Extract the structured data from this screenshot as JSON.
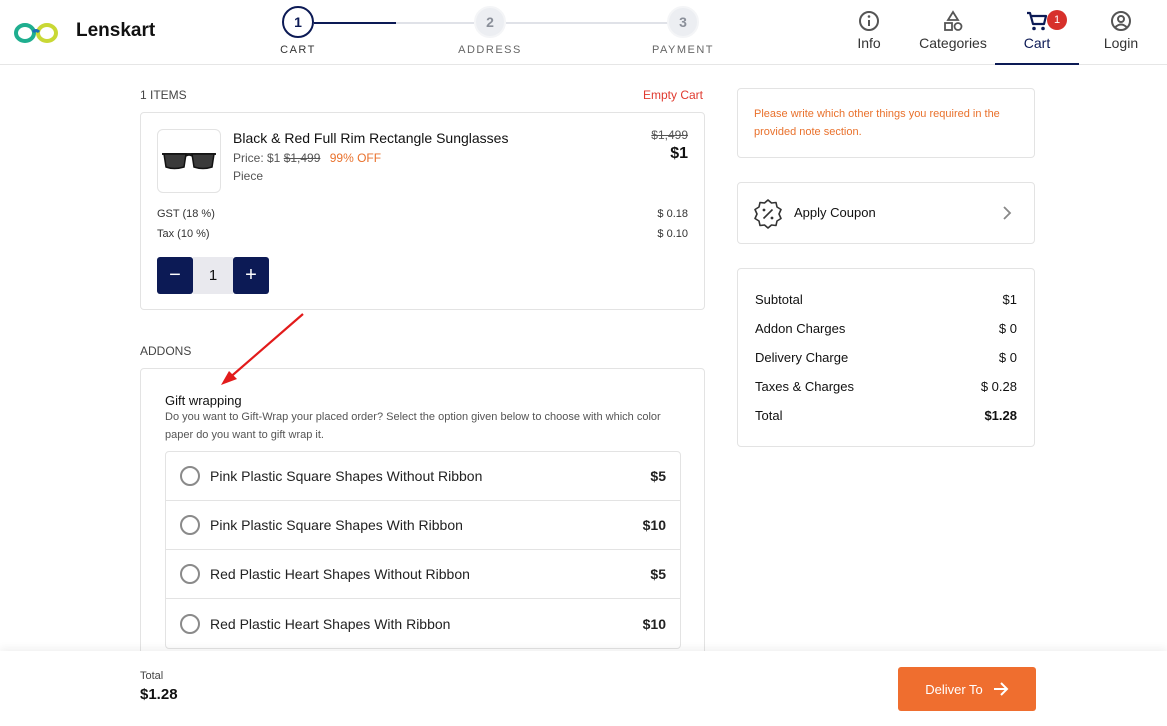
{
  "header": {
    "brand": "Lenskart",
    "steps": [
      {
        "number": "1",
        "label": "CART"
      },
      {
        "number": "2",
        "label": "ADDRESS"
      },
      {
        "number": "3",
        "label": "PAYMENT"
      }
    ],
    "nav": {
      "info": "Info",
      "categories": "Categories",
      "cart": "Cart",
      "cart_count": "1",
      "login": "Login"
    }
  },
  "cart": {
    "items_count": "1 ITEMS",
    "empty_cart": "Empty Cart",
    "item": {
      "name": "Black & Red Full Rim Rectangle Sunglasses",
      "price_prefix": "Price: $1",
      "mrp": "$1,499",
      "discount": "99% OFF",
      "unit": "Piece",
      "mrp_right": "$1,499",
      "price_right": "$1"
    },
    "fees": [
      {
        "label": "GST (18 %)",
        "value": "$ 0.18"
      },
      {
        "label": "Tax (10 %)",
        "value": "$ 0.10"
      }
    ],
    "quantity": "1",
    "qty_minus": "−",
    "qty_plus": "+"
  },
  "addons": {
    "label": "ADDONS",
    "title": "Gift wrapping",
    "description": "Do you want to Gift-Wrap your placed order? Select the option given below to choose with which color paper do you want to gift wrap it.",
    "options": [
      {
        "name": "Pink Plastic Square Shapes Without Ribbon",
        "price": "$5"
      },
      {
        "name": "Pink Plastic Square Shapes With Ribbon",
        "price": "$10"
      },
      {
        "name": "Red Plastic Heart Shapes Without Ribbon",
        "price": "$5"
      },
      {
        "name": "Red Plastic Heart Shapes With Ribbon",
        "price": "$10"
      }
    ]
  },
  "sidebar": {
    "note": "Please write which other things you required in the provided note section.",
    "coupon": "Apply Coupon",
    "summary": [
      {
        "label": "Subtotal",
        "value": "$1"
      },
      {
        "label": "Addon Charges",
        "value": "$ 0"
      },
      {
        "label": "Delivery Charge",
        "value": "$ 0"
      },
      {
        "label": "Taxes & Charges",
        "value": "$ 0.28"
      },
      {
        "label": "Total",
        "value": "$1.28"
      }
    ]
  },
  "footer": {
    "total_label": "Total",
    "total_value": "$1.28",
    "deliver_button": "Deliver To"
  },
  "colors": {
    "brand_navy": "#0c1a55",
    "accent_orange": "#ef6e2f",
    "danger_red": "#e03a2f",
    "badge_red": "#d7302b"
  },
  "icons": [
    "lenskart-logo-icon",
    "info-icon",
    "categories-icon",
    "cart-icon",
    "user-icon",
    "coupon-icon",
    "chevron-right-icon",
    "arrow-right-icon",
    "sunglasses-image",
    "annotation-arrow"
  ]
}
